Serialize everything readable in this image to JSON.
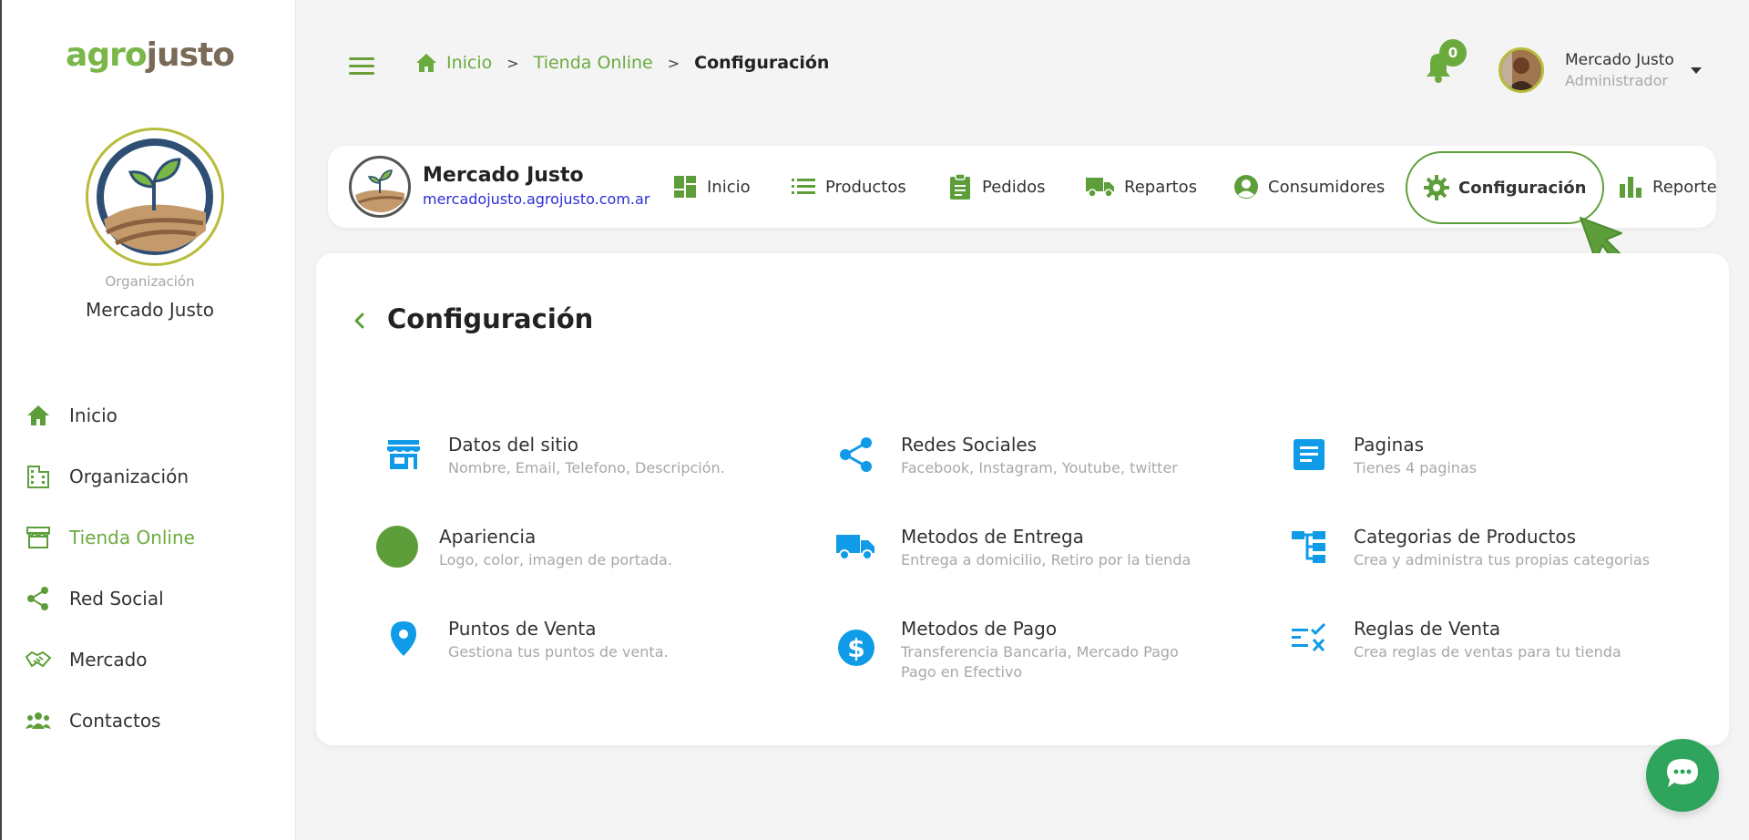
{
  "logo": {
    "agro": "agro",
    "justo": "justo"
  },
  "sidebar": {
    "org_label": "Organización",
    "org_name": "Mercado Justo",
    "items": [
      {
        "label": "Inicio",
        "icon": "home-icon"
      },
      {
        "label": "Organización",
        "icon": "building-icon"
      },
      {
        "label": "Tienda Online",
        "icon": "store-icon",
        "active": true
      },
      {
        "label": "Red Social",
        "icon": "share-icon"
      },
      {
        "label": "Mercado",
        "icon": "handshake-icon"
      },
      {
        "label": "Contactos",
        "icon": "contacts-icon"
      }
    ]
  },
  "breadcrumb": {
    "home": "Inicio",
    "store": "Tienda Online",
    "current": "Configuración"
  },
  "header": {
    "notifications": "0",
    "user_name": "Mercado Justo",
    "user_role": "Administrador"
  },
  "store_nav": {
    "title": "Mercado Justo",
    "url": "mercadojusto.agrojusto.com.ar",
    "items": [
      {
        "label": "Inicio",
        "icon": "dashboard-icon"
      },
      {
        "label": "Productos",
        "icon": "list-icon"
      },
      {
        "label": "Pedidos",
        "icon": "clipboard-icon"
      },
      {
        "label": "Repartos",
        "icon": "truck-icon"
      },
      {
        "label": "Consumidores",
        "icon": "user-circle-icon"
      },
      {
        "label": "Configuración",
        "icon": "gear-icon",
        "active": true
      },
      {
        "label": "Reportes",
        "icon": "bar-chart-icon"
      }
    ]
  },
  "main": {
    "title": "Configuración",
    "options": [
      {
        "title": "Datos del sitio",
        "desc": "Nombre, Email, Telefono, Descripción.",
        "icon": "storefront-icon"
      },
      {
        "title": "Redes Sociales",
        "desc": "Facebook, Instagram, Youtube, twitter",
        "icon": "share-icon"
      },
      {
        "title": "Paginas",
        "desc": "Tienes 4 paginas",
        "icon": "document-icon"
      },
      {
        "title": "Apariencia",
        "desc": "Logo, color, imagen de portada.",
        "icon": "color-circle-icon"
      },
      {
        "title": "Metodos de Entrega",
        "desc": "Entrega a domicilio, Retiro por la tienda",
        "icon": "truck-icon"
      },
      {
        "title": "Categorias de Productos",
        "desc": "Crea y administra tus propias categorias",
        "icon": "hierarchy-icon"
      },
      {
        "title": "Puntos de Venta",
        "desc": "Gestiona tus puntos de venta.",
        "icon": "location-pin-icon"
      },
      {
        "title": "Metodos de Pago",
        "desc": "Transferencia Bancaria, Mercado Pago",
        "desc2": "Pago en Efectivo",
        "icon": "dollar-icon"
      },
      {
        "title": "Reglas de Venta",
        "desc": "Crea reglas de ventas para tu tienda",
        "icon": "rules-icon"
      }
    ]
  },
  "colors": {
    "green": "#6bab3e",
    "blue": "#0f9be8",
    "apariencia": "#5e9e3a",
    "chat": "#2ea45d"
  }
}
